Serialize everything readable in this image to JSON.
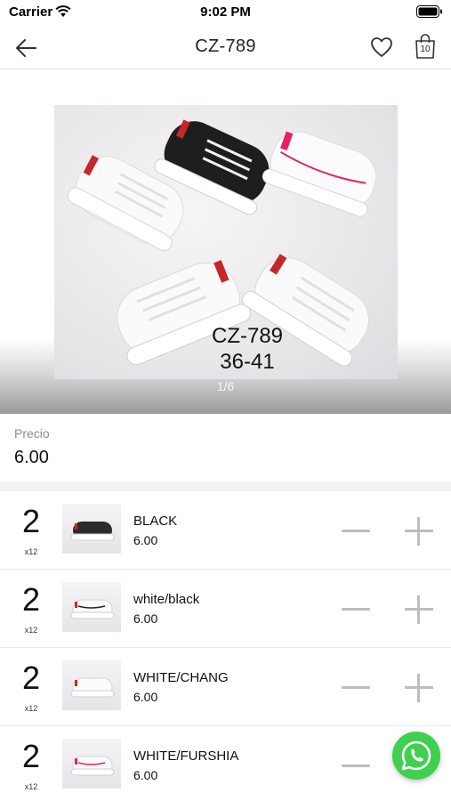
{
  "status_bar": {
    "carrier": "Carrier",
    "time": "9:02 PM"
  },
  "nav": {
    "title": "CZ-789",
    "back_icon": "arrow-left-icon",
    "favorite_icon": "heart-icon",
    "bag_icon": "shopping-bag-icon",
    "bag_count": "10"
  },
  "gallery": {
    "caption_code": "CZ-789",
    "caption_sizes": "36-41",
    "pager": "1/6"
  },
  "price": {
    "label": "Precio",
    "value": "6.00"
  },
  "variants": [
    {
      "qty": "2",
      "multiplier": "x12",
      "name": "BLACK",
      "price": "6.00",
      "shoe_color": "#2b2b2b"
    },
    {
      "qty": "2",
      "multiplier": "x12",
      "name": "white/black",
      "price": "6.00",
      "shoe_color": "#f7f7f7"
    },
    {
      "qty": "2",
      "multiplier": "x12",
      "name": "WHITE/CHANG",
      "price": "6.00",
      "shoe_color": "#f7f7f7"
    },
    {
      "qty": "2",
      "multiplier": "x12",
      "name": "WHITE/FURSHIA",
      "price": "6.00",
      "shoe_color": "#f7f7f7"
    }
  ],
  "colors": {
    "whatsapp": "#3fd04f",
    "divider": "#ececec",
    "stepper": "#bdbdbd"
  }
}
